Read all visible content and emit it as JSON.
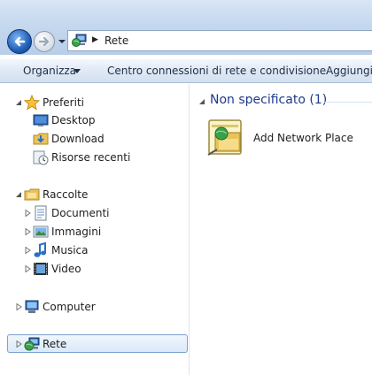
{
  "address_bar": {
    "path_segment": "Rete",
    "icons": [
      "back-arrow-icon",
      "forward-arrow-icon",
      "history-dropdown-icon",
      "network-icon",
      "breadcrumb-separator-icon"
    ]
  },
  "command_bar": {
    "organize_label": "Organizza",
    "network_center_label": "Centro connessioni di rete e condivisione",
    "add_label": "Aggiungi"
  },
  "nav_pane": {
    "favorites": {
      "label": "Preferiti",
      "items": [
        {
          "label": "Desktop",
          "icon": "desktop-icon"
        },
        {
          "label": "Download",
          "icon": "download-folder-icon"
        },
        {
          "label": "Risorse recenti",
          "icon": "recent-places-icon"
        }
      ]
    },
    "libraries": {
      "label": "Raccolte",
      "items": [
        {
          "label": "Documenti",
          "icon": "documents-icon"
        },
        {
          "label": "Immagini",
          "icon": "pictures-icon"
        },
        {
          "label": "Musica",
          "icon": "music-icon"
        },
        {
          "label": "Video",
          "icon": "video-icon"
        }
      ]
    },
    "computer": {
      "label": "Computer",
      "icon": "computer-icon"
    },
    "network": {
      "label": "Rete",
      "icon": "network-icon",
      "selected": true
    }
  },
  "content": {
    "group_title": "Non specificato (1)",
    "items": [
      {
        "label": "Add Network Place",
        "icon": "add-network-place-icon"
      }
    ]
  },
  "colors": {
    "group_title": "#1e3a8c",
    "selection_border": "#7da2ce",
    "command_bar_top": "#f4f8fd",
    "command_bar_bottom": "#d3e0f0"
  }
}
